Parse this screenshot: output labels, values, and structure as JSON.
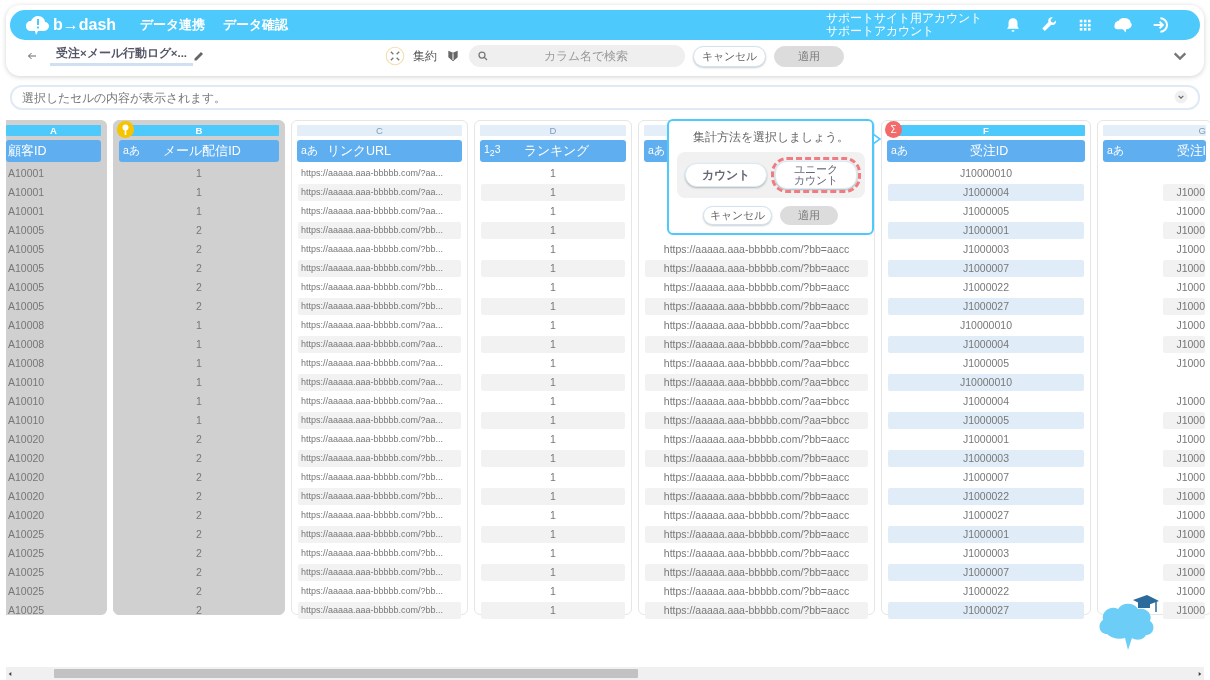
{
  "header": {
    "logo": "b→dash",
    "nav": [
      "データ連携",
      "データ確認"
    ],
    "account": [
      "サポートサイト用アカウント",
      "サポートアカウント"
    ]
  },
  "toolbar": {
    "title": "受注×メール行動ログ×...",
    "aggregate_label": "集約",
    "search": {
      "placeholder": "カラム名で検索"
    },
    "cancel": "キャンセル",
    "apply": {
      "label": "適用",
      "disabled": true
    }
  },
  "formula_bar": {
    "placeholder": "選択したセルの内容が表示されます。"
  },
  "popover": {
    "title": "集計方法を選択しましょう。",
    "options": [
      {
        "label": "カウント",
        "selected": false
      },
      {
        "label_lines": [
          "ユニーク",
          "カウント"
        ],
        "selected": true
      }
    ],
    "cancel": "キャンセル",
    "apply": {
      "label": "適用",
      "disabled": true
    }
  },
  "columns": [
    {
      "letter": "A",
      "name": "顧客ID",
      "grouped": true,
      "selected": false,
      "cells": [
        "A10001",
        "A10001",
        "A10001",
        "A10005",
        "A10005",
        "A10005",
        "A10005",
        "A10005",
        "A10008",
        "A10008",
        "A10008",
        "A10010",
        "A10010",
        "A10010",
        "A10020",
        "A10020",
        "A10020",
        "A10020",
        "A10020",
        "A10025",
        "A10025",
        "A10025",
        "A10025",
        "A10025"
      ]
    },
    {
      "letter": "B",
      "name": "メール配信ID",
      "type_label": "aあ",
      "badge": {
        "kind": "key"
      },
      "grouped": true,
      "selected": false,
      "cells": [
        "1",
        "1",
        "1",
        "2",
        "2",
        "2",
        "2",
        "2",
        "1",
        "1",
        "1",
        "1",
        "1",
        "1",
        "2",
        "2",
        "2",
        "2",
        "2",
        "2",
        "2",
        "2",
        "2",
        "2"
      ]
    },
    {
      "letter": "C",
      "name": "リンクURL",
      "type_label": "aあ",
      "grouped": false,
      "selected": false,
      "cells": [
        "https://aaaaa.aaa-bbbbb.com/?aa...",
        "https://aaaaa.aaa-bbbbb.com/?aa...",
        "https://aaaaa.aaa-bbbbb.com/?aa...",
        "https://aaaaa.aaa-bbbbb.com/?bb...",
        "https://aaaaa.aaa-bbbbb.com/?bb...",
        "https://aaaaa.aaa-bbbbb.com/?bb...",
        "https://aaaaa.aaa-bbbbb.com/?bb...",
        "https://aaaaa.aaa-bbbbb.com/?bb...",
        "https://aaaaa.aaa-bbbbb.com/?aa...",
        "https://aaaaa.aaa-bbbbb.com/?aa...",
        "https://aaaaa.aaa-bbbbb.com/?aa...",
        "https://aaaaa.aaa-bbbbb.com/?aa...",
        "https://aaaaa.aaa-bbbbb.com/?aa...",
        "https://aaaaa.aaa-bbbbb.com/?aa...",
        "https://aaaaa.aaa-bbbbb.com/?bb...",
        "https://aaaaa.aaa-bbbbb.com/?bb...",
        "https://aaaaa.aaa-bbbbb.com/?bb...",
        "https://aaaaa.aaa-bbbbb.com/?bb...",
        "https://aaaaa.aaa-bbbbb.com/?bb...",
        "https://aaaaa.aaa-bbbbb.com/?bb...",
        "https://aaaaa.aaa-bbbbb.com/?bb...",
        "https://aaaaa.aaa-bbbbb.com/?bb...",
        "https://aaaaa.aaa-bbbbb.com/?bb...",
        "https://aaaaa.aaa-bbbbb.com/?bb..."
      ]
    },
    {
      "letter": "D",
      "name": "ランキング",
      "type_label": "1$_{2}$3",
      "grouped": false,
      "selected": false,
      "cells": [
        "1",
        "1",
        "1",
        "1",
        "1",
        "1",
        "1",
        "1",
        "1",
        "1",
        "1",
        "1",
        "1",
        "1",
        "1",
        "1",
        "1",
        "1",
        "1",
        "1",
        "1",
        "1",
        "1",
        "1"
      ]
    },
    {
      "type_label": "aあ",
      "grouped": false,
      "selected": false,
      "cells": [
        null,
        null,
        null,
        null,
        "https://aaaaa.aaa-bbbbb.com/?bb=aacc",
        "https://aaaaa.aaa-bbbbb.com/?bb=aacc",
        "https://aaaaa.aaa-bbbbb.com/?bb=aacc",
        "https://aaaaa.aaa-bbbbb.com/?bb=aacc",
        "https://aaaaa.aaa-bbbbb.com/?aa=bbcc",
        "https://aaaaa.aaa-bbbbb.com/?aa=bbcc",
        "https://aaaaa.aaa-bbbbb.com/?aa=bbcc",
        "https://aaaaa.aaa-bbbbb.com/?aa=bbcc",
        "https://aaaaa.aaa-bbbbb.com/?aa=bbcc",
        "https://aaaaa.aaa-bbbbb.com/?aa=bbcc",
        "https://aaaaa.aaa-bbbbb.com/?bb=aacc",
        "https://aaaaa.aaa-bbbbb.com/?bb=aacc",
        "https://aaaaa.aaa-bbbbb.com/?bb=aacc",
        "https://aaaaa.aaa-bbbbb.com/?bb=aacc",
        "https://aaaaa.aaa-bbbbb.com/?bb=aacc",
        "https://aaaaa.aaa-bbbbb.com/?bb=aacc",
        "https://aaaaa.aaa-bbbbb.com/?bb=aacc",
        "https://aaaaa.aaa-bbbbb.com/?bb=aacc",
        "https://aaaaa.aaa-bbbbb.com/?bb=aacc",
        "https://aaaaa.aaa-bbbbb.com/?bb=aacc"
      ]
    },
    {
      "letter": "F",
      "name": "受注ID",
      "type_label": "aあ",
      "badge": {
        "kind": "sum",
        "text": "Σ"
      },
      "grouped": false,
      "selected": true,
      "cells": [
        "J10000010",
        "J1000004",
        "J1000005",
        "J1000001",
        "J1000003",
        "J1000007",
        "J1000022",
        "J1000027",
        "J10000010",
        "J1000004",
        "J1000005",
        "J10000010",
        "J1000004",
        "J1000005",
        "J1000001",
        "J1000003",
        "J1000007",
        "J1000022",
        "J1000027",
        "J1000001",
        "J1000003",
        "J1000007",
        "J1000022",
        "J1000027"
      ]
    },
    {
      "letter": "G",
      "name": "受注I",
      "type_label": "aあ",
      "grouped": false,
      "selected": false,
      "cells": [
        null,
        "J1000",
        "J1000",
        "J1000",
        "J1000",
        "J1000",
        "J1000",
        "J1000",
        "J1000",
        "J1000",
        "J1000",
        null,
        "J1000",
        "J1000",
        "J1000",
        "J1000",
        "J1000",
        "J1000",
        "J1000",
        "J1000",
        "J1000",
        "J1000",
        "J1000",
        "J1000"
      ]
    }
  ]
}
